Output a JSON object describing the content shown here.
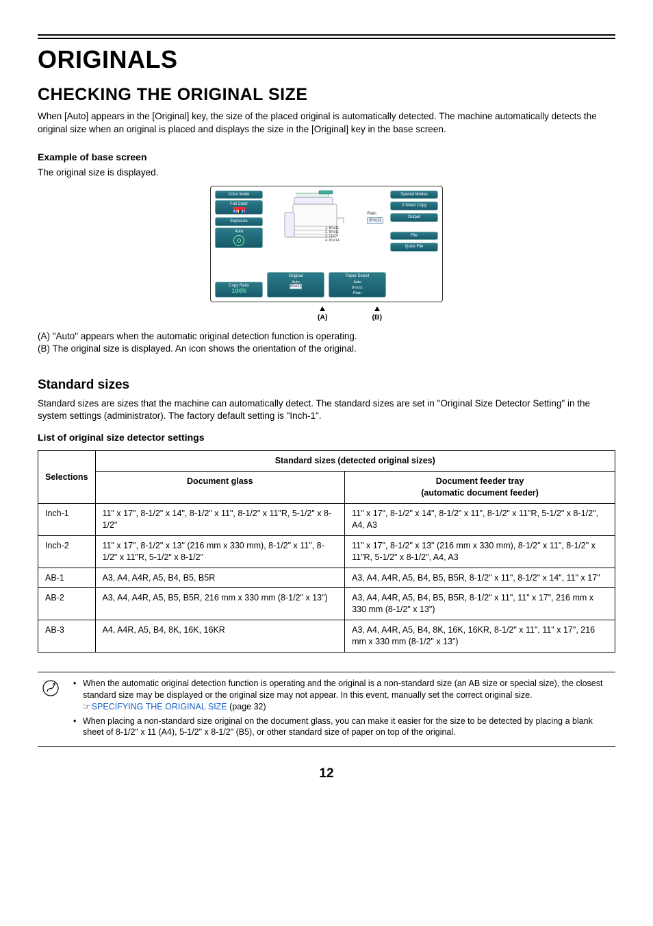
{
  "title_main": "ORIGINALS",
  "title_sub": "CHECKING THE ORIGINAL SIZE",
  "intro": "When [Auto] appears in the [Original] key, the size of the placed original is automatically detected. The machine automatically detects the original size when an original is placed and displays the size in the [Original] key in the base screen.",
  "example_head": "Example of base screen",
  "example_desc": "The original size is displayed.",
  "screen": {
    "color_mode": "Color Mode",
    "full_color": "Full Color",
    "exposure": "Exposure",
    "auto": "Auto",
    "copy_ratio": "Copy Ratio",
    "ratio_val": "100%",
    "original": "Original",
    "original_auto": "Auto",
    "original_size": "8½x11",
    "paper_select": "Paper Select",
    "paper_auto": "Auto",
    "paper_size": "8½x11",
    "paper_type": "Plain",
    "special_modes": "Special Modes",
    "two_sided": "2-Sided Copy",
    "output": "Output",
    "file": "File",
    "quick_file": "Quick File",
    "plain_label": "Plain",
    "plain_size": "8½x11",
    "trays": {
      "t1": "1.        8½x11",
      "t2": "2.        8½x11",
      "t3": "3.     11x17",
      "t4": "4.   8½x14"
    }
  },
  "mark_a": "(A)",
  "mark_b": "(B)",
  "note_a": "(A) \"Auto\" appears when the automatic original detection function is operating.",
  "note_b": "(B) The original size is displayed. An icon shows the orientation of the original.",
  "std_head": "Standard sizes",
  "std_desc": "Standard sizes are sizes that the machine can automatically detect. The standard sizes are set in \"Original Size Detector Setting\" in the system settings (administrator). The factory default setting is \"Inch-1\".",
  "list_head": "List of original size detector settings",
  "table": {
    "h_sel": "Selections",
    "h_std": "Standard sizes (detected original sizes)",
    "h_glass": "Document glass",
    "h_feeder": "Document feeder tray\n(automatic document feeder)",
    "rows": [
      {
        "sel": "Inch-1",
        "glass": "11\" x 17\", 8-1/2\" x 14\", 8-1/2\" x 11\", 8-1/2\" x 11\"R, 5-1/2\" x 8-1/2\"",
        "feeder": "11\" x 17\", 8-1/2\" x 14\", 8-1/2\" x 11\", 8-1/2\" x 11\"R, 5-1/2\" x 8-1/2\", A4, A3"
      },
      {
        "sel": "Inch-2",
        "glass": "11\" x 17\", 8-1/2\" x 13\" (216 mm x 330 mm), 8-1/2\" x 11\", 8-1/2\" x 11\"R, 5-1/2\" x 8-1/2\"",
        "feeder": "11\" x 17\", 8-1/2\" x 13\" (216 mm x 330 mm), 8-1/2\" x 11\", 8-1/2\" x 11\"R, 5-1/2\" x 8-1/2\", A4, A3"
      },
      {
        "sel": "AB-1",
        "glass": "A3, A4, A4R, A5, B4, B5, B5R",
        "feeder": "A3, A4, A4R, A5, B4, B5, B5R, 8-1/2\" x 11\", 8-1/2\" x 14\", 11\" x 17\""
      },
      {
        "sel": "AB-2",
        "glass": "A3, A4, A4R, A5, B5, B5R, 216 mm x 330 mm (8-1/2\" x 13\")",
        "feeder": "A3, A4, A4R, A5, B4, B5, B5R, 8-1/2\" x 11\", 11\" x 17\", 216 mm x 330 mm (8-1/2\" x 13\")"
      },
      {
        "sel": "AB-3",
        "glass": "A4, A4R, A5, B4, 8K, 16K, 16KR",
        "feeder": "A3, A4, A4R, A5, B4, 8K, 16K, 16KR, 8-1/2\" x 11\", 11\" x 17\", 216 mm x 330 mm (8-1/2\" x 13\")"
      }
    ]
  },
  "footnote": {
    "b1": "When the automatic original detection function is operating and the original is a non-standard size (an AB size or special size), the closest standard size may be displayed or the original size may not appear. In this event, manually set the correct original size.",
    "link": "SPECIFYING THE ORIGINAL SIZE",
    "link_suffix": " (page 32)",
    "b2": "When placing a non-standard size original on the document glass, you can make it easier for the size to be detected by placing a blank sheet of 8-1/2\" x 11 (A4), 5-1/2\" x 8-1/2\" (B5), or other standard size of paper on top of the original."
  },
  "page_number": "12"
}
